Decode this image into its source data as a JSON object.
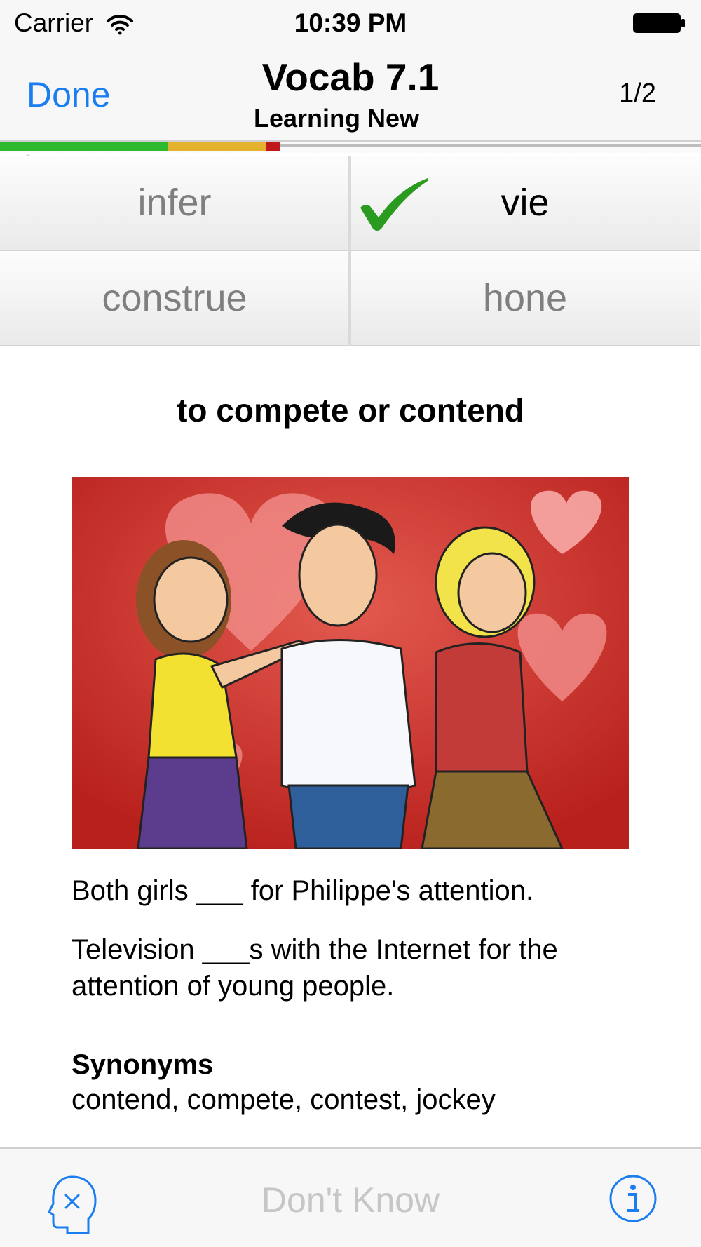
{
  "status_bar": {
    "carrier": "Carrier",
    "time": "10:39 PM"
  },
  "nav": {
    "done_label": "Done",
    "title": "Vocab 7.1",
    "subtitle": "Learning New",
    "counter": "1/2"
  },
  "progress": {
    "segments": [
      {
        "status": "known",
        "fraction": 0.24,
        "color": "#2eb82e"
      },
      {
        "status": "learning",
        "fraction": 0.14,
        "color": "#e4b22c"
      },
      {
        "status": "missed",
        "fraction": 0.02,
        "color": "#c0181b"
      }
    ]
  },
  "choices": [
    {
      "label": "infer",
      "selected": false
    },
    {
      "label": "vie",
      "selected": true
    },
    {
      "label": "construe",
      "selected": false
    },
    {
      "label": "hone",
      "selected": false
    }
  ],
  "definition": "to compete or contend",
  "examples": [
    "Both girls ___ for Philippe's attention.",
    "Television ___s with the Internet for the attention of young people."
  ],
  "synonyms": {
    "heading": "Synonyms",
    "list": "contend, compete, contest, jockey"
  },
  "toolbar": {
    "dont_know_label": "Don't Know"
  },
  "colors": {
    "accent": "#1a7ef0",
    "check": "#2a9b1f"
  },
  "icons": [
    "wifi-icon",
    "battery-icon",
    "checkmark-icon",
    "head-x-icon",
    "info-icon"
  ]
}
